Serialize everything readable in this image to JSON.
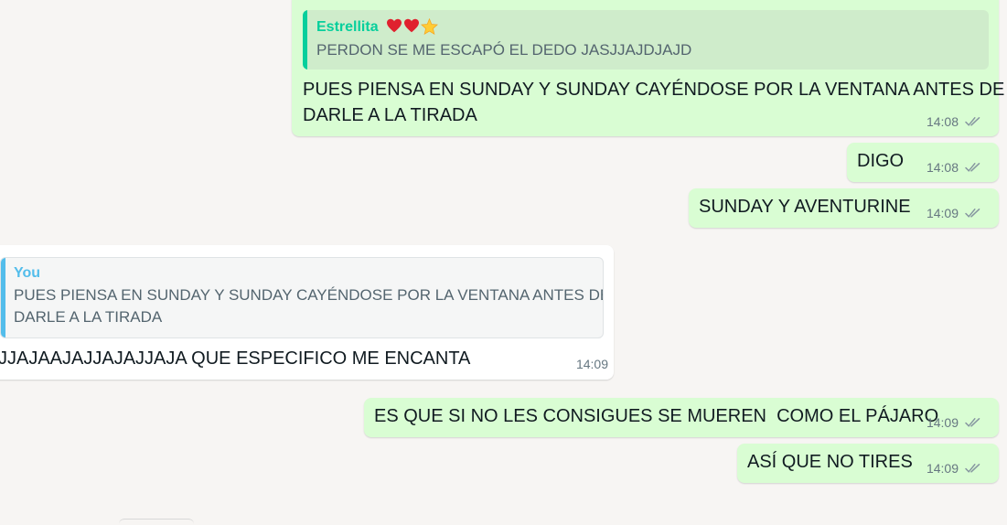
{
  "messages": {
    "m1": {
      "quote_author": "Estrellita",
      "quote_text": "PERDON SE ME ESCAPÓ EL DEDO JASJJAJDJAJD",
      "line1": "PUES PIENSA EN SUNDAY Y SUNDAY CAYÉNDOSE POR LA VENTANA ANTES DE",
      "line2": "DARLE A LA TIRADA",
      "time": "14:08"
    },
    "m2": {
      "text": "DIGO",
      "time": "14:08"
    },
    "m3": {
      "text": "SUNDAY Y AVENTURINE",
      "time": "14:09"
    },
    "m4": {
      "quote_author": "You",
      "quote_line1": "PUES PIENSA EN SUNDAY Y SUNDAY CAYÉNDOSE POR LA VENTANA ANTES DE",
      "quote_line2": "DARLE A LA TIRADA",
      "text": "JJAJAAJAJJAJAJJAJA QUE ESPECIFICO ME ENCANTA",
      "time": "14:09"
    },
    "m5": {
      "text": "ES QUE SI NO LES CONSIGUES SE MUEREN  COMO EL PÁJARO",
      "time": "14:09"
    },
    "m6": {
      "text": "ASÍ QUE NO TIRES",
      "time": "14:09"
    }
  },
  "colors": {
    "outgoing_bubble": "#d9fdd3",
    "incoming_bubble": "#ffffff",
    "quote_author_estrellita": "#06cf9c",
    "quote_author_you": "#53bdeb",
    "read_ticks": "#8696a0"
  },
  "icons": [
    "red-heart-icon",
    "red-heart-icon",
    "glowing-star-icon",
    "double-check-icon"
  ]
}
